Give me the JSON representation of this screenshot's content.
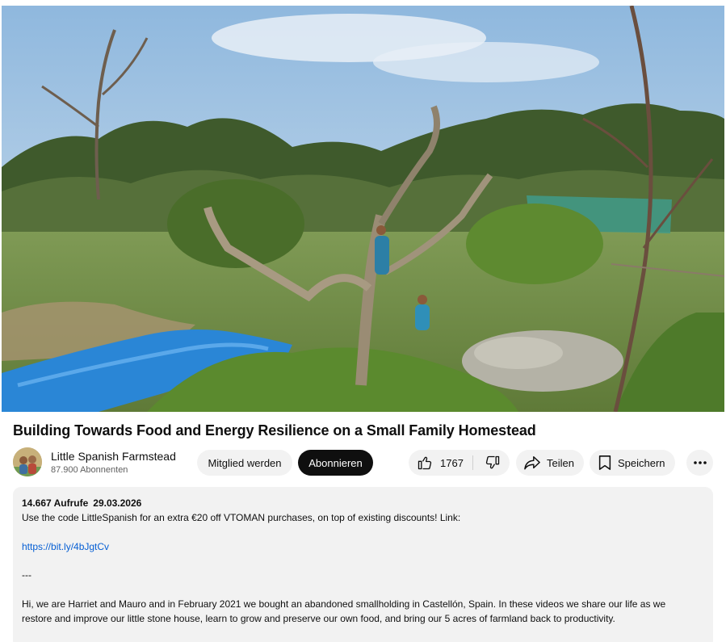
{
  "video": {
    "title": "Building Towards Food and Energy Resilience on a Small Family Homestead"
  },
  "channel": {
    "name": "Little Spanish Farmstead",
    "subscribers": "87.900 Abonnenten"
  },
  "actions": {
    "join_label": "Mitglied werden",
    "subscribe_label": "Abonnieren",
    "like_count": "1767",
    "share_label": "Teilen",
    "save_label": "Speichern"
  },
  "description": {
    "views": "14.667 Aufrufe",
    "date": "29.03.2026",
    "line1": "Use the code LittleSpanish for an extra €20 off VTOMAN purchases, on top of existing discounts! Link:",
    "link": "https://bit.ly/4bJgtCv",
    "separator": "---",
    "line3": "Hi, we are Harriet and Mauro and in February 2021 we bought an abandoned smallholding in Castellón, Spain. In these videos we share our life as we",
    "line4": "restore and improve our little stone house, learn to grow and preserve our own food, and bring our 5 acres of farmland back to productivity."
  },
  "icons": {
    "like": "thumbs-up-icon",
    "dislike": "thumbs-down-icon",
    "share": "share-arrow-icon",
    "save": "bookmark-icon",
    "more": "more-horizontal-icon"
  },
  "colors": {
    "subscribe_bg": "#0f0f0f",
    "pill_bg": "#f2f2f2",
    "link": "#065fd4",
    "secondary_text": "#606060"
  }
}
